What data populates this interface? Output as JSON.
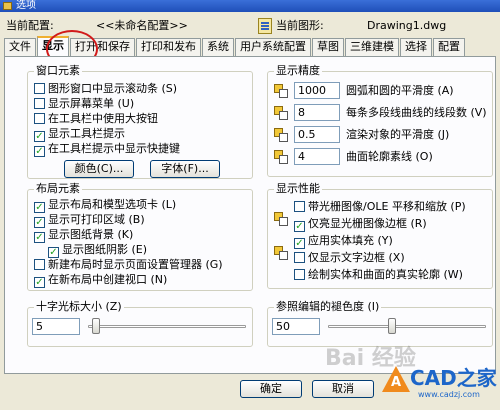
{
  "window": {
    "title": "选项"
  },
  "profile": {
    "label": "当前配置:",
    "value": "<<未命名配置>>",
    "drawing_label": "当前图形:",
    "drawing_value": "Drawing1.dwg"
  },
  "tabs": [
    {
      "label": "文件"
    },
    {
      "label": "显示"
    },
    {
      "label": "打开和保存"
    },
    {
      "label": "打印和发布"
    },
    {
      "label": "系统"
    },
    {
      "label": "用户系统配置"
    },
    {
      "label": "草图"
    },
    {
      "label": "三维建模"
    },
    {
      "label": "选择"
    },
    {
      "label": "配置"
    }
  ],
  "window_elements": {
    "title": "窗口元素",
    "items": [
      {
        "label": "图形窗口中显示滚动条 (S)",
        "checked": false
      },
      {
        "label": "显示屏幕菜单 (U)",
        "checked": false
      },
      {
        "label": "在工具栏中使用大按钮",
        "checked": false
      },
      {
        "label": "显示工具栏提示",
        "checked": true
      },
      {
        "label": "在工具栏提示中显示快捷键",
        "checked": true
      }
    ],
    "colors_button": "颜色(C)...",
    "fonts_button": "字体(F)..."
  },
  "layout_elements": {
    "title": "布局元素",
    "items": [
      {
        "label": "显示布局和模型选项卡 (L)",
        "checked": true
      },
      {
        "label": "显示可打印区域 (B)",
        "checked": true
      },
      {
        "label": "显示图纸背景 (K)",
        "checked": true
      },
      {
        "label": "显示图纸阴影 (E)",
        "checked": true
      },
      {
        "label": "新建布局时显示页面设置管理器 (G)",
        "checked": false
      },
      {
        "label": "在新布局中创建视口 (N)",
        "checked": true
      }
    ]
  },
  "crosshair": {
    "title": "十字光标大小 (Z)",
    "value": "5",
    "level": 5
  },
  "display_resolution": {
    "title": "显示精度",
    "items": [
      {
        "value": "1000",
        "label": "圆弧和圆的平滑度 (A)"
      },
      {
        "value": "8",
        "label": "每条多段线曲线的线段数 (V)"
      },
      {
        "value": "0.5",
        "label": "渲染对象的平滑度 (J)"
      },
      {
        "value": "4",
        "label": "曲面轮廓素线 (O)"
      }
    ]
  },
  "display_performance": {
    "title": "显示性能",
    "items": [
      {
        "label": "带光栅图像/OLE 平移和缩放 (P)",
        "checked": false
      },
      {
        "label": "仅亮显光栅图像边框 (R)",
        "checked": true
      },
      {
        "label": "应用实体填充 (Y)",
        "checked": true
      },
      {
        "label": "仅显示文字边框 (X)",
        "checked": false
      },
      {
        "label": "绘制实体和曲面的真实轮廓 (W)",
        "checked": false
      }
    ]
  },
  "xref_fading": {
    "title": "参照编辑的褪色度 (I)",
    "value": "50",
    "level": 50
  },
  "footer": {
    "ok": "确定",
    "cancel": "取消"
  },
  "watermark": {
    "text": "Bai 经验"
  },
  "logo": {
    "big": "CAD之家",
    "url": "www.cadzj.com",
    "mark": "A"
  }
}
